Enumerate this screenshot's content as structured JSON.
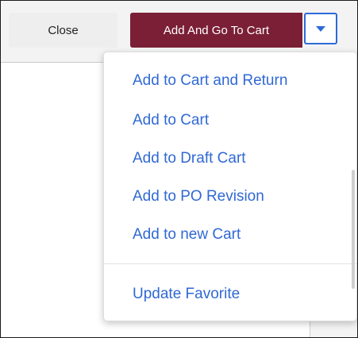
{
  "toolbar": {
    "close_label": "Close",
    "primary_label": "Add And Go To Cart"
  },
  "menu": {
    "items": [
      {
        "label": "Add to Cart and Return"
      },
      {
        "label": "Add to Cart"
      },
      {
        "label": "Add to Draft Cart"
      },
      {
        "label": "Add to PO Revision"
      },
      {
        "label": "Add to new Cart"
      }
    ],
    "footer_item": {
      "label": "Update Favorite"
    }
  },
  "colors": {
    "primary": "#7a1f36",
    "accent": "#2d6ad8",
    "link": "#3069d4"
  },
  "icons": {
    "toggle": "caret-down-icon"
  }
}
